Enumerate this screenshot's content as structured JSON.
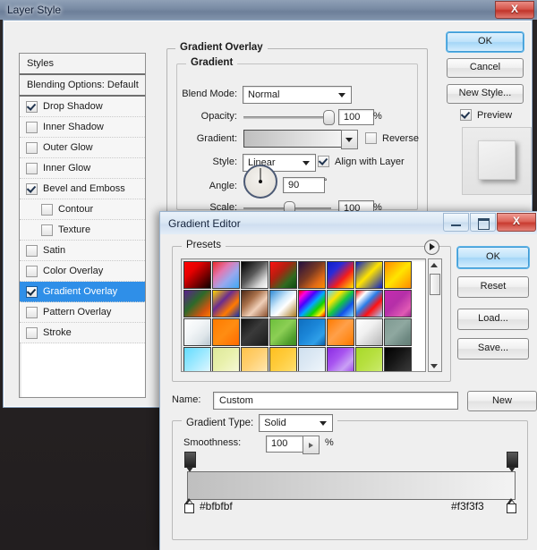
{
  "layer_style": {
    "title": "Layer Style",
    "close_label": "X",
    "styles_panel": {
      "header": "Styles",
      "blending_options": "Blending Options: Default",
      "items": [
        {
          "label": "Drop Shadow",
          "checked": true,
          "indent": false,
          "selected": false
        },
        {
          "label": "Inner Shadow",
          "checked": false,
          "indent": false,
          "selected": false
        },
        {
          "label": "Outer Glow",
          "checked": false,
          "indent": false,
          "selected": false
        },
        {
          "label": "Inner Glow",
          "checked": false,
          "indent": false,
          "selected": false
        },
        {
          "label": "Bevel and Emboss",
          "checked": true,
          "indent": false,
          "selected": false
        },
        {
          "label": "Contour",
          "checked": false,
          "indent": true,
          "selected": false
        },
        {
          "label": "Texture",
          "checked": false,
          "indent": true,
          "selected": false
        },
        {
          "label": "Satin",
          "checked": false,
          "indent": false,
          "selected": false
        },
        {
          "label": "Color Overlay",
          "checked": false,
          "indent": false,
          "selected": false
        },
        {
          "label": "Gradient Overlay",
          "checked": true,
          "indent": false,
          "selected": true
        },
        {
          "label": "Pattern Overlay",
          "checked": false,
          "indent": false,
          "selected": false
        },
        {
          "label": "Stroke",
          "checked": false,
          "indent": false,
          "selected": false
        }
      ]
    },
    "gradient_overlay": {
      "group_title": "Gradient Overlay",
      "subgroup_title": "Gradient",
      "blend_mode_label": "Blend Mode:",
      "blend_mode_value": "Normal",
      "opacity_label": "Opacity:",
      "opacity_value": "100",
      "opacity_unit": "%",
      "gradient_label": "Gradient:",
      "gradient_from": "#bfbfbf",
      "gradient_to": "#f3f3f3",
      "reverse_label": "Reverse",
      "reverse_checked": false,
      "style_label": "Style:",
      "style_value": "Linear",
      "align_label": "Align with Layer",
      "align_checked": true,
      "angle_label": "Angle:",
      "angle_value": "90",
      "angle_unit": "°",
      "scale_label": "Scale:",
      "scale_value": "100",
      "scale_unit": "%"
    },
    "buttons": {
      "ok": "OK",
      "cancel": "Cancel",
      "new_style": "New Style...",
      "preview_label": "Preview",
      "preview_checked": true
    }
  },
  "gradient_editor": {
    "title": "Gradient Editor",
    "window_buttons": {
      "minimize": "minimize-icon",
      "maximize": "maximize-icon",
      "close": "X"
    },
    "presets": {
      "legend": "Presets",
      "menu_icon": "preset-menu-arrow-icon",
      "swatches": [
        {
          "name": "foreground-to-background-red",
          "css": "linear-gradient(135deg,#ff0000 0%,#e60000 32%,#7a0000 66%,#0b0000 100%)"
        },
        {
          "name": "red-white-blue-checker",
          "css": "linear-gradient(135deg,#ef2b2b 0%,#e07ab4 35%,#9aa8ee 62%,#3fa9f5 100%)"
        },
        {
          "name": "black-to-white",
          "css": "linear-gradient(135deg,#000000 0%,#5a5a5a 45%,#d8d8d8 78%,#ffffff 100%)"
        },
        {
          "name": "red-to-green",
          "css": "linear-gradient(135deg,#ff1111 0%,#b02010 38%,#2f6b1f 72%,#0d4a12 100%)"
        },
        {
          "name": "violet-orange",
          "css": "linear-gradient(135deg,#241040 0%,#7a3a22 45%,#e06a16 75%,#ff8c00 100%)"
        },
        {
          "name": "blue-red-yellow",
          "css": "linear-gradient(135deg,#0b1fc9 0%,#2b2bd8 30%,#f41d1d 62%,#ffe400 100%)"
        },
        {
          "name": "blue-yellow-blue",
          "css": "linear-gradient(135deg,#0a1fc9 0%,#ffe400 48%,#0a1fc9 100%)"
        },
        {
          "name": "orange-yellow-orange",
          "css": "linear-gradient(135deg,#ff8a00 0%,#ffe400 50%,#ff8a00 100%)"
        },
        {
          "name": "violet-green-orange",
          "css": "linear-gradient(135deg,#5b1f8f 0%,#2c6a2a 42%,#d2540f 78%,#ff7a00 100%)"
        },
        {
          "name": "yellow-violet-orange-blue",
          "css": "linear-gradient(135deg,#ffd400 0%,#6a2c8f 38%,#ff7a00 68%,#1230b5 100%)"
        },
        {
          "name": "copper",
          "css": "linear-gradient(135deg,#4e2a18 0%,#a8704a 35%,#f0cfb8 62%,#8a4f2d 100%)"
        },
        {
          "name": "chrome",
          "css": "linear-gradient(135deg,#2f8bd6 0%,#cfe9fb 40%,#ffffff 58%,#a9791f 100%)"
        },
        {
          "name": "spectrum",
          "css": "linear-gradient(135deg,#ff0000 0%,#ff00e0 16%,#4a00ff 34%,#00a8ff 52%,#14d200 70%,#ffee00 86%,#ff0000 100%)"
        },
        {
          "name": "transparent-rainbow",
          "css": "linear-gradient(135deg,#59d4ff 0%,#ffe400 28%,#16c742 50%,#1352e8 72%,#7fd8ff 100%)"
        },
        {
          "name": "transparent-stripes",
          "css": "linear-gradient(135deg,#ff1111 0%,#ffffff 22%,#2b7de8 44%,#ff1111 66%,#9fd4ff 100%)"
        },
        {
          "name": "magenta-purple",
          "css": "linear-gradient(135deg,#c52bb0 0%,#b52fa8 45%,#e05ab4 80%,#9a2a8c 100%)"
        },
        {
          "name": "white-to-silver",
          "css": "linear-gradient(135deg,#ffffff 0%,#f2f5f7 40%,#dfe6ea 70%,#b8c6cf 100%)"
        },
        {
          "name": "orange-solid",
          "css": "linear-gradient(135deg,#ff7a00 0%,#ff8d12 50%,#ff6a00 100%)"
        },
        {
          "name": "black-charcoal",
          "css": "linear-gradient(135deg,#111111 0%,#3a3a3a 45%,#2a2a2a 75%,#1a1a1a 100%)"
        },
        {
          "name": "green-gradient",
          "css": "linear-gradient(135deg,#6dbf3c 0%,#8ccf55 45%,#4f9e2c 80%,#3d8a22 100%)"
        },
        {
          "name": "blue-gradient",
          "css": "linear-gradient(135deg,#0f6fc0 0%,#1b86d8 45%,#2f9fe8 75%,#0c5ea8 100%)"
        },
        {
          "name": "orange-peach",
          "css": "linear-gradient(135deg,#ff7a00 0%,#ffa04a 45%,#ff8a1c 78%,#f57200 100%)"
        },
        {
          "name": "white-grey",
          "css": "linear-gradient(135deg,#ffffff 0%,#f0f0f0 42%,#d2d2d2 72%,#b5b5b5 100%)"
        },
        {
          "name": "sage-grey",
          "css": "linear-gradient(135deg,#7f9a92 0%,#8fa8a0 45%,#6f8a83 78%,#637e76 100%)"
        },
        {
          "name": "cyan-light",
          "css": "linear-gradient(135deg,#63dcff 0%,#9ae8ff 45%,#c9f2ff 80%,#eafaff 100%)"
        },
        {
          "name": "pale-yellow-green",
          "css": "linear-gradient(135deg,#dde89a 0%,#e8f0ab 45%,#f2f6c8 80%,#f7fadf 100%)"
        },
        {
          "name": "light-orange",
          "css": "linear-gradient(135deg,#ffc24a 0%,#ffd071 45%,#ffe09c 80%,#ffedc4 100%)"
        },
        {
          "name": "golden-yellow",
          "css": "linear-gradient(135deg,#ffbf1f 0%,#ffcc3d 45%,#ffd95e 80%,#ffe58a 100%)"
        },
        {
          "name": "pale-blue",
          "css": "linear-gradient(135deg,#cfe0ef 0%,#dde9f4 45%,#eaf2f9 80%,#f5f9fc 100%)"
        },
        {
          "name": "purple-violet",
          "css": "linear-gradient(135deg,#8a2be2 0%,#a855f0 40%,#c9a0f5 70%,#9a3fe8 100%)"
        },
        {
          "name": "lime-green",
          "css": "linear-gradient(135deg,#a8d92a 0%,#b6e03f 45%,#c4e75e 80%,#cfec7d 100%)"
        },
        {
          "name": "black-fade",
          "css": "linear-gradient(135deg,#000000 0%,#151515 40%,#2a2a2a 70%,#3d3d3d 100%)"
        }
      ],
      "scrollbar": {
        "up_icon": "scroll-up-arrow-icon",
        "down_icon": "scroll-down-arrow-icon"
      }
    },
    "name_label": "Name:",
    "name_value": "Custom",
    "new_button": "New",
    "gradient_type_label": "Gradient Type:",
    "gradient_type_value": "Solid",
    "smoothness_label": "Smoothness:",
    "smoothness_value": "100",
    "smoothness_unit": "%",
    "gradient_bar": {
      "from_color": "#bfbfbf",
      "to_color": "#f3f3f3",
      "left_stop_label": "#bfbfbf",
      "right_stop_label": "#f3f3f3"
    },
    "buttons": {
      "ok": "OK",
      "reset": "Reset",
      "load": "Load...",
      "save": "Save..."
    }
  }
}
